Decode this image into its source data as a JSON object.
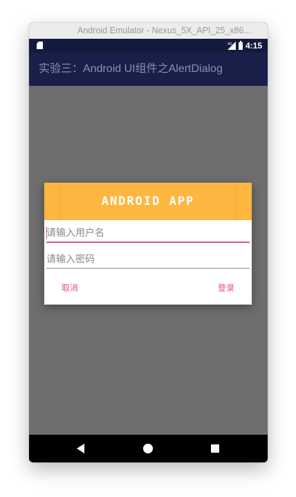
{
  "window": {
    "title": "Android Emulator - Nexus_5X_API_25_x86..."
  },
  "status_bar": {
    "network": "4G",
    "time": "4:15"
  },
  "app_bar": {
    "title": "实验三：Android UI组件之AlertDialog"
  },
  "dialog": {
    "banner_text": "ANDROID APP",
    "username": {
      "value": "",
      "placeholder": "请输入用户名"
    },
    "password": {
      "value": "",
      "placeholder": "请输入密码"
    },
    "cancel_label": "取消",
    "login_label": "登录"
  },
  "colors": {
    "app_bar": "#1a1f49",
    "status_bar": "#141a3d",
    "scrim": "#6e6e6e",
    "banner": "#fdb740",
    "accent": "#e44f85"
  },
  "nav_bar": {
    "icons": [
      "back-icon",
      "home-icon",
      "recents-icon"
    ]
  }
}
